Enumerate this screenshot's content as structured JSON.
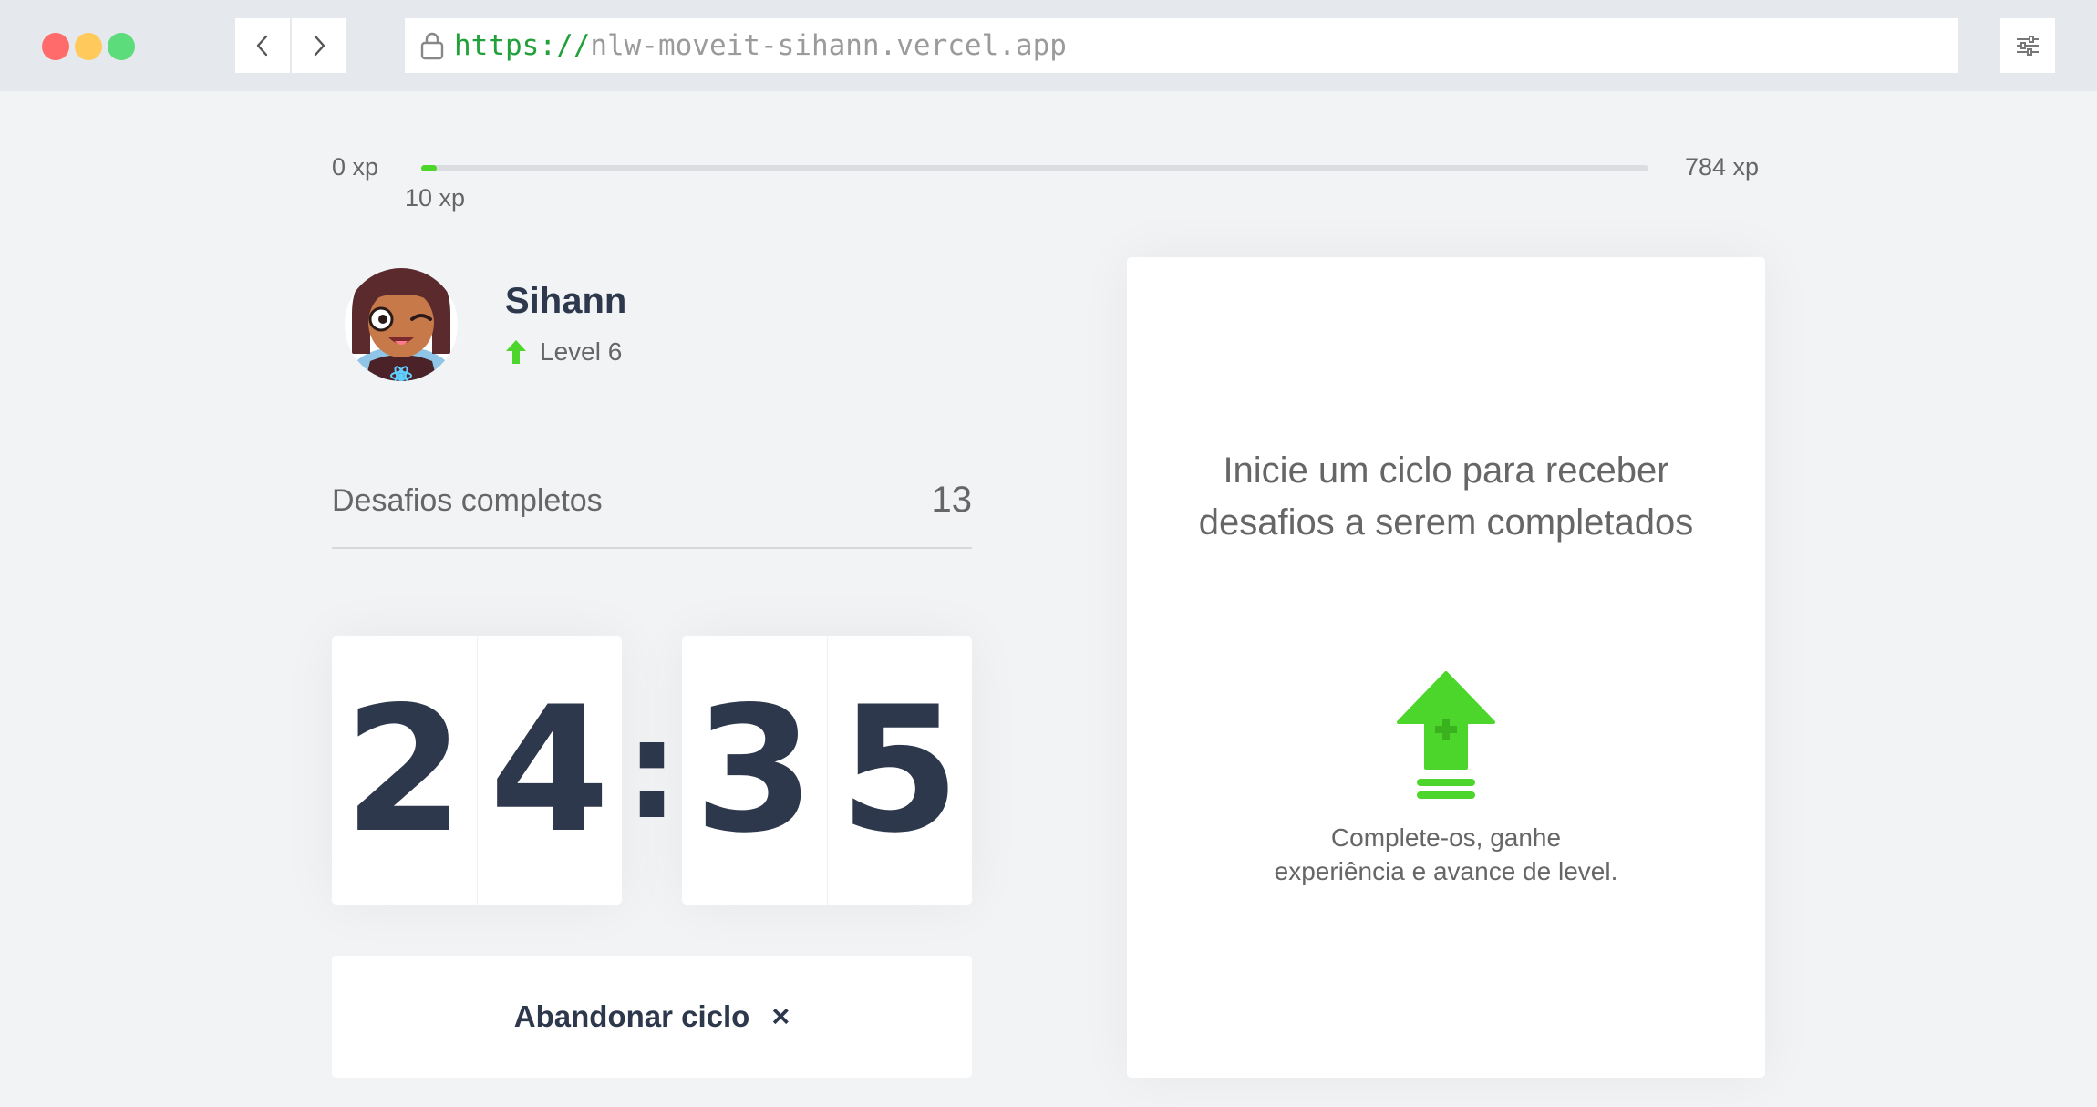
{
  "browser": {
    "url_scheme": "https://",
    "url_host": "nlw-moveit-sihann.vercel.app"
  },
  "xp": {
    "min_label": "0 xp",
    "max_label": "784 xp",
    "current_label": "10 xp",
    "progress_fraction": 0.013,
    "fill_color": "#4cd62b"
  },
  "profile": {
    "name": "Sihann",
    "level_label": "Level 6"
  },
  "completed": {
    "label": "Desafios completos",
    "count": "13"
  },
  "countdown": {
    "minute_left": "2",
    "minute_right": "4",
    "separator": ":",
    "second_left": "3",
    "second_right": "5"
  },
  "abandon_button": {
    "label": "Abandonar ciclo",
    "icon": "×"
  },
  "challenge_card": {
    "heading": "Inicie um ciclo para receber desafios a serem completados",
    "subtext": "Complete-os, ganhe experiência e avance de level."
  },
  "colors": {
    "accent_green": "#4cd62b",
    "title_dark": "#2e384d",
    "text_gray": "#666666"
  }
}
